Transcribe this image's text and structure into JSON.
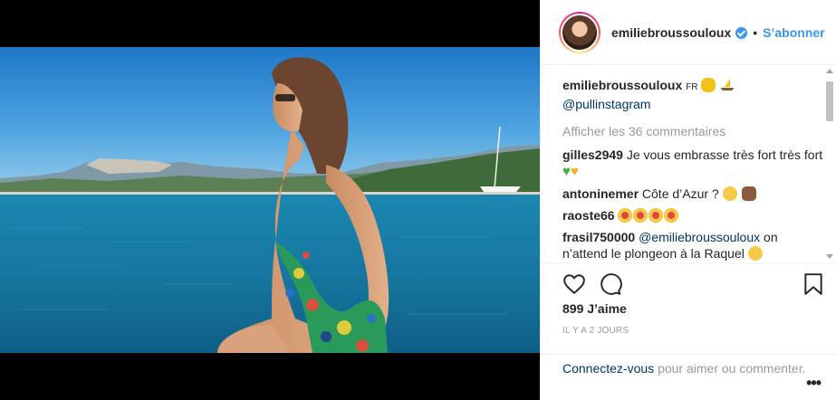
{
  "post": {
    "username": "emiliebroussouloux",
    "follow_label": "S’abonner",
    "separator": "•"
  },
  "caption": {
    "username": "emiliebroussouloux",
    "text": "FR",
    "tag": "@pullinstagram"
  },
  "view_all_comments": "Afficher les 36 commentaires",
  "comments": [
    {
      "user": "gilles2949",
      "text": "Je vous embrasse très fort très fort"
    },
    {
      "user": "antoninemer",
      "text": "Côte d’Azur ?"
    },
    {
      "user": "raoste66",
      "text": ""
    },
    {
      "user": "frasil750000",
      "mention": "@emiliebroussouloux",
      "text": "on n’attend le plongeon à la Raquel"
    }
  ],
  "likes": "899 J’aime",
  "timestamp": "IL Y A 2 JOURS",
  "login_prompt": {
    "link": "Connectez-vous",
    "text": "pour aimer ou commenter."
  },
  "more_label": "•••",
  "icons": {
    "like": "heart-icon",
    "comment": "comment-bubble-icon",
    "save": "bookmark-icon",
    "verified": "verified-badge-icon"
  },
  "colors": {
    "link_blue": "#3897f0",
    "text_dark": "#262626",
    "muted": "#999999",
    "mention": "#003569"
  }
}
